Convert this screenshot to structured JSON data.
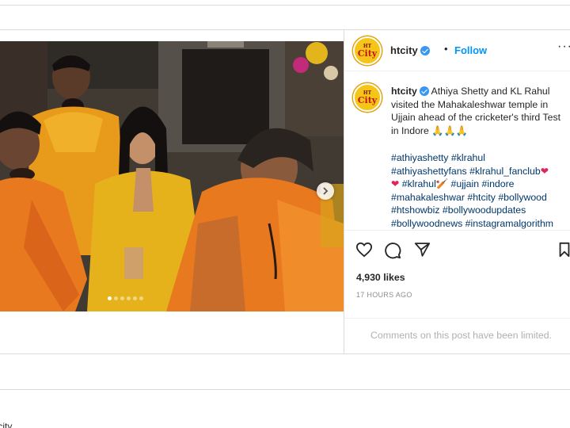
{
  "post": {
    "username": "htcity",
    "follow_label": "Follow",
    "separator": "•",
    "more_label": "···",
    "avatar_text": "HT",
    "avatar_sub": "City",
    "caption": "Athiya Shetty and KL Rahul visited the Mahakaleshwar temple in Ujjain ahead of the cricketer's third Test in Indore 🙏🙏🙏",
    "hashtags_line1": "#athiyashetty #klrahul",
    "hashtags_line2": "#athiyashettyfans #klrahul_fanclub",
    "heart1": "❤",
    "heart2": "❤",
    "hashtags_line3a": "#klrahul🏏 #ujjain #indore",
    "hashtags_line4": "#mahakaleshwar #htcity #bollywood",
    "hashtags_line5": "#htshowbiz #bollywoodupdates",
    "hashtags_line6": "#bollywoodnews #instagramalgorithm",
    "likes": "4,930 likes",
    "time": "17 HOURS AGO",
    "comments_notice": "Comments on this post have been limited.",
    "carousel": {
      "total": 6,
      "active": 1
    }
  },
  "footer": {
    "text": "tcity"
  },
  "icons": {
    "like": "heart-outline-icon",
    "comment": "comment-bubble-icon",
    "share": "paper-plane-icon",
    "save": "bookmark-icon",
    "next": "chevron-right-icon",
    "verified": "verified-badge-icon"
  },
  "colors": {
    "link": "#0095f6",
    "hashtag": "#00376b",
    "verified": "#3897f0",
    "saffron": "#e8791f",
    "yellow": "#e6b21c"
  }
}
